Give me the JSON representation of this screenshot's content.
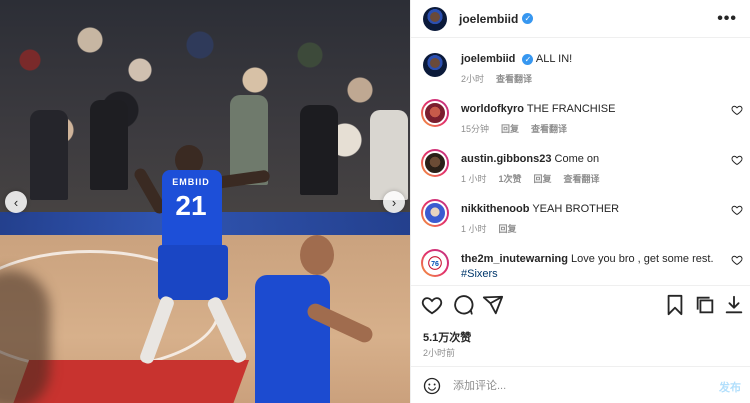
{
  "header": {
    "username": "joelembiid",
    "more": "•••"
  },
  "caption": {
    "username": "joelembiid",
    "text": "ALL IN!",
    "time": "2小时",
    "translate": "查看翻译"
  },
  "comments": [
    {
      "username": "worldofkyro",
      "text": "THE FRANCHISE",
      "time": "15分钟",
      "reply": "回复",
      "translate": "查看翻译"
    },
    {
      "username": "austin.gibbons23",
      "text": "Come on",
      "time": "1 小时",
      "likes": "1次赞",
      "reply": "回复",
      "translate": "查看翻译"
    },
    {
      "username": "nikkithenoob",
      "text": "YEAH BROTHER",
      "time": "1 小时",
      "reply": "回复"
    },
    {
      "username": "the2m_inutewarning",
      "text": "Love you bro , get some rest.",
      "hashtag": "#Sixers"
    }
  ],
  "post": {
    "likes": "5.1万次赞",
    "time": "2小时前"
  },
  "composer": {
    "placeholder": "添加评论...",
    "post_label": "发布"
  },
  "photo": {
    "jersey_name": "EMBIID",
    "jersey_number": "21",
    "nav_left": "‹",
    "nav_right": "›"
  },
  "colors": {
    "verified": "#3797f0",
    "link": "#00376b",
    "muted": "#8e8e8e",
    "post_disabled": "#b2dffc"
  }
}
